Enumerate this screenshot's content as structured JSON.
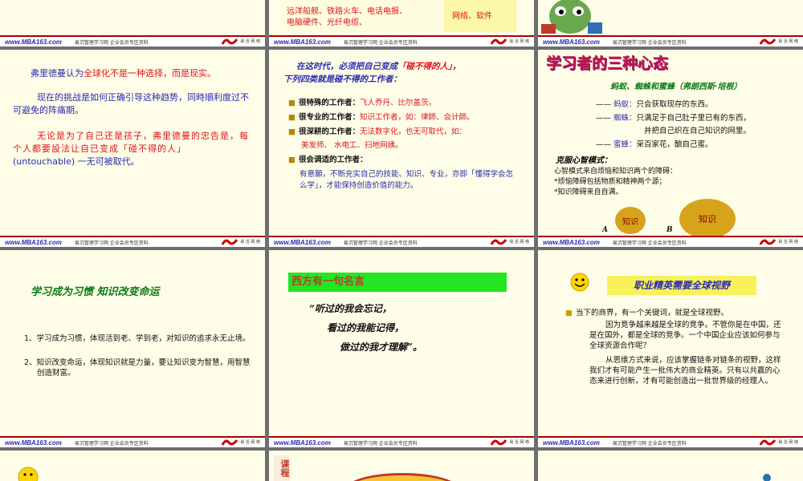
{
  "footer": {
    "brand": "www.MBA163.com",
    "nets": "易沉管理学习网 企业会员专区资料",
    "logo_text": "易 活 网 络"
  },
  "slides": {
    "r0a": {
      "line1": "远洋船舰、铁路火车、电话电报、",
      "line2": "电脑硬件、光纤电缆、",
      "right": "网络、软件"
    },
    "s7": {
      "p1_pre": "弗里德曼认为",
      "p1_hl": "全球化不是一种选择，而是现实。",
      "p2": "现在的挑战是如何正确引导这种趋势，同時順利度过不可避免的阵痛期。",
      "p3_pre": "无论是为了自己还是孩子，弗里德曼的忠告是，每个人都要設法让自已变成「碰不得的人」",
      "p3_en": "(untouchable)",
      "p3_post": "一无可被取代。"
    },
    "s8": {
      "h1_pre": "在这时代，必须把自己变成",
      "h1_hl": "「碰不得的人」",
      "h1_post": "，",
      "h2": "下列四类就是碰不得的工作者：",
      "items": [
        {
          "label": "很特殊的工作者：",
          "desc": "飞人乔丹、比尔盖茨。"
        },
        {
          "label": "很专业的工作者：",
          "desc": "知识工作者，如：律師、会计師。"
        },
        {
          "label": "很深耕的工作者：",
          "desc": "无法数字化，也无可取代，如：",
          "desc2": "美发师、 水电工、扫地网姨。"
        },
        {
          "label": "很会调适的工作者：",
          "desc": "有意願，不断充实自己的技能、知识、专业，亦即「懂得学会怎么学」，才能保持创造价值的能力。"
        }
      ]
    },
    "s9": {
      "title": "学习者的三种心态",
      "subtitle": "蚂蚁、蜘蛛和蜜蜂（弗朗西斯·培根）",
      "rows": [
        {
          "dash": "——",
          "name": "蚂蚁：",
          "text": "只会获取现存的东西。"
        },
        {
          "dash": "——",
          "name": "蜘蛛：",
          "text": "只满足于自己肚子里已有的东西，",
          "text2": "并把自己织在自己知识的网里。"
        },
        {
          "dash": "——",
          "name": "蜜蜂：",
          "text": "采百家花，酿自己蜜。"
        }
      ],
      "overcome_title": "克服心智模式：",
      "lines": [
        "心智模式来自烦恼和知识两个的障碍：",
        "*烦恼障碍包括物质和精神两个源；",
        "*知识障碍来自自满。"
      ],
      "circle_small": "知识",
      "circle_big": "知识",
      "label_a": "A",
      "label_b": "B"
    },
    "s10": {
      "title": "学习成为习惯 知识改变命运",
      "items": [
        {
          "num": "1、",
          "text": "学习成为习惯，体现活到老、学到老，对知识的追求永无止境。"
        },
        {
          "num": "2、",
          "text": "知识改变命运，体现知识就是力量，要让知识变为智慧，用智慧创造财富。"
        }
      ]
    },
    "s11": {
      "banner": "西方有一句名言",
      "q1": "“听过的我会忘记，",
      "q2": "看过的我能记得，",
      "q3": "做过的我才理解",
      "q_end": "”。"
    },
    "s12": {
      "banner": "职业精英需要全球视野",
      "p1": "当下的商界，有一个关键词，就是全球视野。",
      "p2": "因为竞争越来越是全球的竞争。不管你是在中国，还是在国外，都是全球的竞争。一个中国企业应该如何参与全球资源合作呢？",
      "p3": "从思维方式来说，应该掌握链条对链条的视野，这样我们才有可能产生一批伟大的商业精英。只有以共赢的心态来进行创新，才有可能创造出一批世界级的经理人。"
    },
    "r3": {
      "label": "课程"
    }
  },
  "colors": {
    "slide_bg": "#fefde7",
    "accent_red": "#e0141e",
    "accent_blue": "#2b2bb0",
    "banner_green": "#22e622",
    "banner_yellow": "#f7f25a",
    "footer_line": "#a80000"
  }
}
